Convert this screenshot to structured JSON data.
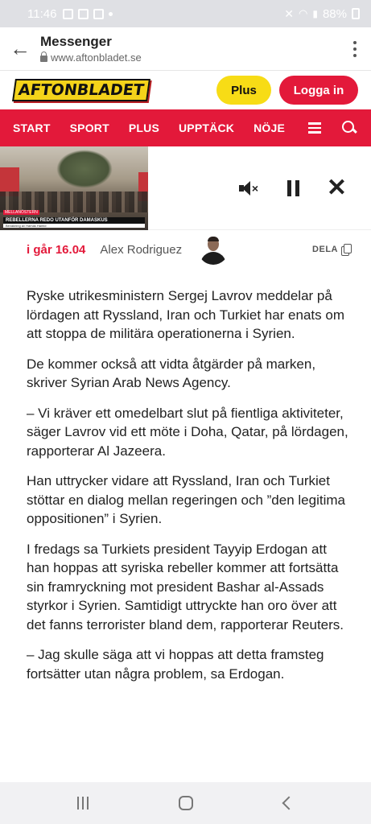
{
  "status_bar": {
    "time": "11:46",
    "battery": "88%"
  },
  "browser": {
    "title": "Messenger",
    "url": "www.aftonbladet.se"
  },
  "site": {
    "logo": "AFTONBLADET",
    "plus_label": "Plus",
    "login_label": "Logga in",
    "colors": {
      "brand_red": "#e3193a",
      "brand_yellow": "#f7dc16"
    }
  },
  "nav": {
    "items": [
      "START",
      "SPORT",
      "PLUS",
      "UPPTÄCK",
      "NÖJE"
    ]
  },
  "video": {
    "caption_tag": "MELLANÖSTERN",
    "caption_main": "REBELLERNA REDO UTANFÖR DAMASKUS",
    "caption_sub": "Bevakning av Hamas Hamid"
  },
  "byline": {
    "date": "i går 16.04",
    "author": "Alex Rodriguez",
    "share_label": "DELA"
  },
  "article": {
    "paragraphs": [
      "Ryske utrikesministern Sergej Lavrov meddelar på lördagen att Ryssland, Iran och Turkiet har enats om att stoppa de militära operationerna i Syrien.",
      "De kommer också att vidta åtgärder på marken, skriver Syrian Arab News Agency.",
      "– Vi kräver ett omedelbart slut på fientliga aktiviteter, säger Lavrov vid ett möte i Doha, Qatar, på lördagen, rapporterar Al Jazeera.",
      "Han uttrycker vidare att Ryssland, Iran och Turkiet stöttar en dialog mellan regeringen och ”den legitima oppositionen” i Syrien.",
      "I fredags sa Turkiets president Tayyip Erdogan att han hoppas att syriska rebeller kommer att fortsätta sin framryckning mot president Bashar al-Assads styrkor i Syrien. Samtidigt uttryckte han oro över att det fanns terrorister bland dem, rapporterar Reuters.",
      "– Jag skulle säga att vi hoppas att detta framsteg fortsätter utan några problem, sa Erdogan."
    ]
  }
}
